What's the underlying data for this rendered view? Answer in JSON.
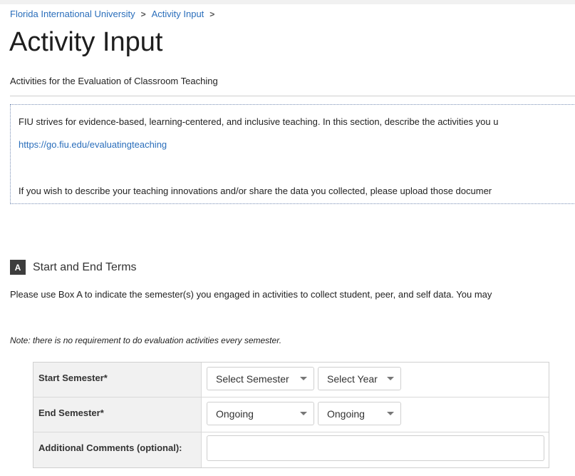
{
  "breadcrumb": {
    "items": [
      "Florida International University",
      "Activity Input"
    ],
    "separator": ">"
  },
  "page": {
    "title": "Activity Input",
    "subtitle": "Activities for the Evaluation of Classroom Teaching"
  },
  "info_box": {
    "line1": "FIU strives for evidence-based, learning-centered, and inclusive teaching. In this section, describe the activities you u",
    "link": "https://go.fiu.edu/evaluatingteaching",
    "line3": "If you wish to describe your teaching innovations and/or share the data you collected, please upload those documer"
  },
  "section_a": {
    "badge": "A",
    "title": "Start and End Terms",
    "instructions": "Please use Box A to indicate the semester(s) you engaged in activities to collect student, peer, and self data.  You may",
    "note": "Note: there is no requirement to do evaluation activities every semester."
  },
  "form": {
    "start_label": "Start Semester*",
    "start_semester": "Select Semester",
    "start_year": "Select Year",
    "end_label": "End Semester*",
    "end_semester": "Ongoing",
    "end_year": "Ongoing",
    "comments_label": "Additional Comments (optional):",
    "comments_value": ""
  },
  "colors": {
    "link": "#2a6ebb",
    "badge": "#3d3d3d",
    "label_bg": "#f1f1f1"
  }
}
